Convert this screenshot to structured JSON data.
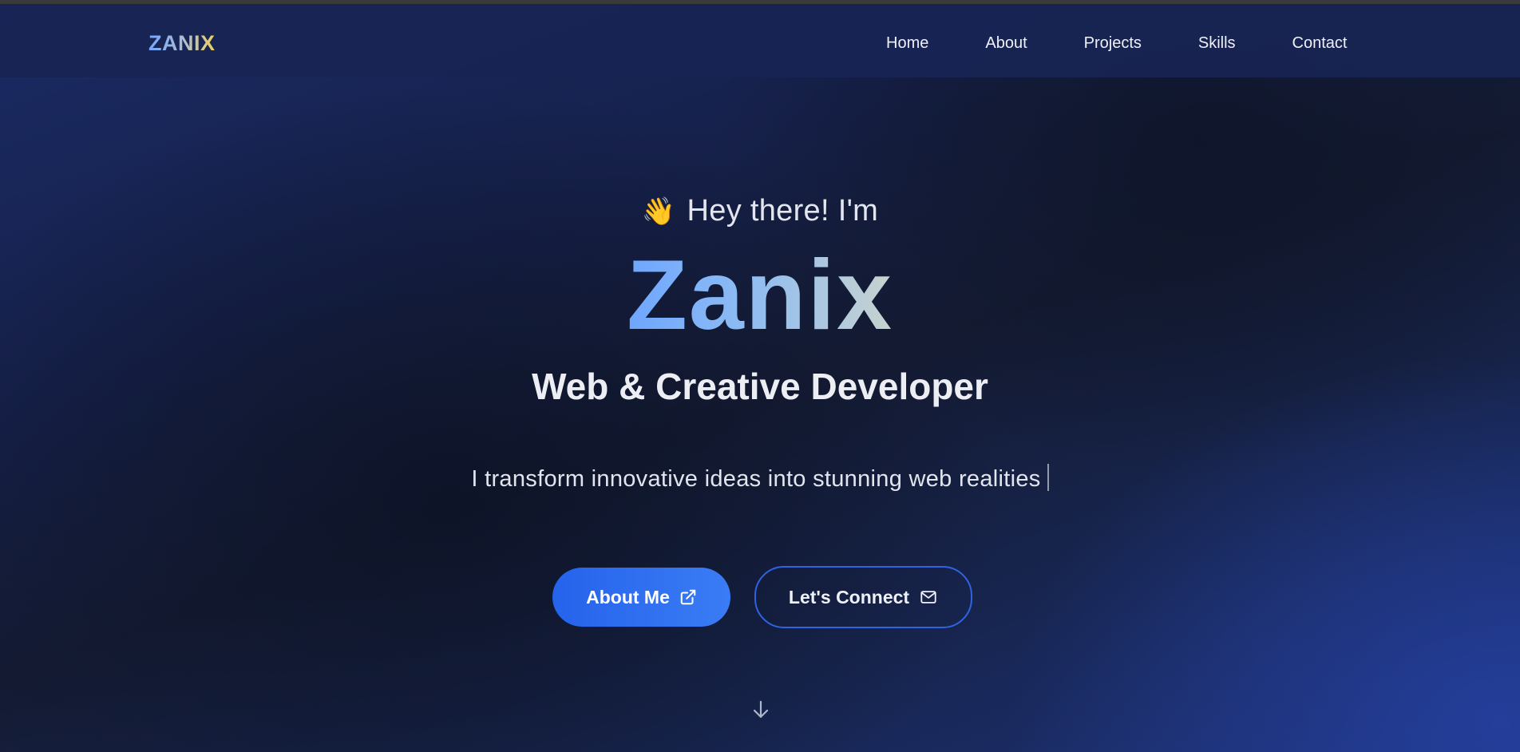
{
  "nav": {
    "logo": "ZANIX",
    "links": [
      "Home",
      "About",
      "Projects",
      "Skills",
      "Contact"
    ]
  },
  "hero": {
    "greeting_emoji": "👋",
    "greeting": "Hey there! I'm",
    "name": "Zanix",
    "role": "Web & Creative Developer",
    "tagline": "I transform innovative ideas into stunning web realities",
    "primary_button": "About Me",
    "primary_button_icon": "external-link-icon",
    "secondary_button": "Let's Connect",
    "secondary_button_icon": "mail-icon",
    "scroll_icon": "arrow-down-icon"
  },
  "colors": {
    "accent": "#2563eb",
    "logo_gradient_start": "#74a4ff",
    "logo_gradient_end": "#f0d15b",
    "background_dark": "#141b33",
    "background_blue": "#1e3278"
  }
}
